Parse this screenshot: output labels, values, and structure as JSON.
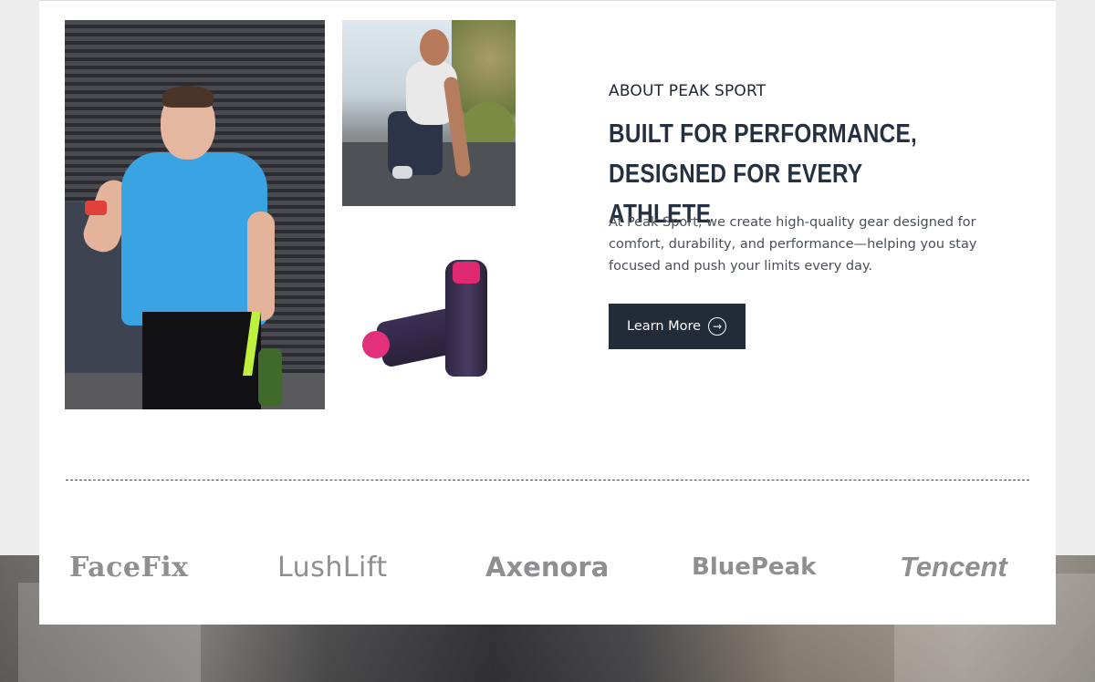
{
  "about": {
    "eyebrow": "ABOUT PEAK SPORT",
    "headline": "Built for Performance, Designed for Every Athlete",
    "description": "At Peak Sport, we create high-quality gear designed for comfort, durability, and performance—helping you stay focused and push your limits every day.",
    "button_label": "Learn More"
  },
  "partners": {
    "logos": [
      "FaceFix",
      "LushLift",
      "Axenora",
      "BluePeak",
      "Tencent"
    ]
  },
  "icons": {
    "button_icon": "arrow-right-circle-icon"
  },
  "colors": {
    "button_bg": "#222b38",
    "heading": "#253040",
    "logo_gray": "#8f8f93"
  }
}
